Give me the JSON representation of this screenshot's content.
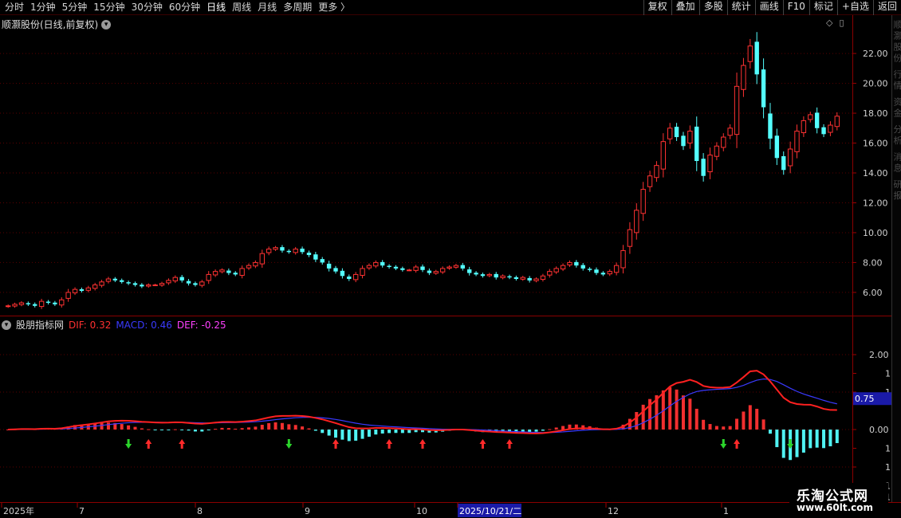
{
  "toolbar": {
    "left_items": [
      "分时",
      "1分钟",
      "5分钟",
      "15分钟",
      "30分钟",
      "60分钟",
      "日线",
      "周线",
      "月线",
      "多周期",
      "更多"
    ],
    "active": "日线",
    "more_glyph": "〉",
    "right_items": [
      "复权",
      "叠加",
      "多股",
      "统计",
      "画线",
      "F10",
      "标记",
      "+自选",
      "返回"
    ]
  },
  "main": {
    "title": "顺灏股份(日线,前复权)",
    "toggle_icon": "chevron-down-icon",
    "corner_icons": [
      "◇",
      "▯"
    ]
  },
  "price_axis": {
    "ticks": [
      "22.00",
      "20.00",
      "18.00",
      "16.00",
      "14.00",
      "12.00",
      "10.00",
      "8.00",
      "6.00"
    ]
  },
  "indicator": {
    "name": "股朋指标网",
    "dif_label": "DIF: 0.32",
    "macd_label": "MACD: 0.46",
    "def_label": "DEF: -0.25",
    "axis_ticks": [
      "2.00",
      "1",
      "1",
      "0.00",
      "1",
      "1",
      "1",
      "1"
    ],
    "current_value": "0.75"
  },
  "date_axis": {
    "labels": [
      "2025年",
      "7",
      "8",
      "9",
      "10",
      "2025/10/21/二",
      "12",
      "1"
    ]
  },
  "side_strip_text": "顺灏股份 行情 资金 分析 消息 研报",
  "watermark": {
    "name": "乐淘公式网",
    "url": "www.60lt.com"
  },
  "colors": {
    "up": "#ff3232",
    "down": "#54ffff",
    "dif": "#ff2020",
    "dea": "#3a3aff",
    "grid": "#5a0000",
    "highlight": "#1a1aa8"
  },
  "chart_data": {
    "type": "candlestick",
    "series_y_range": [
      4.5,
      23.5
    ],
    "closes": [
      5.1,
      5.2,
      5.3,
      5.2,
      5.1,
      5.4,
      5.3,
      5.2,
      5.5,
      6.0,
      6.2,
      6.1,
      6.3,
      6.5,
      6.7,
      6.9,
      6.8,
      6.7,
      6.6,
      6.5,
      6.4,
      6.5,
      6.5,
      6.6,
      6.8,
      7.0,
      6.8,
      6.6,
      6.5,
      6.7,
      7.2,
      7.4,
      7.5,
      7.3,
      7.2,
      7.6,
      7.8,
      8.0,
      8.6,
      8.9,
      9.0,
      8.8,
      8.7,
      8.9,
      8.7,
      8.5,
      8.2,
      8.0,
      7.6,
      7.4,
      7.1,
      6.9,
      7.2,
      7.6,
      7.8,
      8.0,
      7.8,
      7.7,
      7.6,
      7.5,
      7.5,
      7.7,
      7.5,
      7.3,
      7.4,
      7.6,
      7.7,
      7.8,
      7.6,
      7.3,
      7.2,
      7.1,
      7.2,
      7.0,
      7.1,
      7.0,
      6.9,
      7.0,
      6.8,
      6.9,
      7.1,
      7.4,
      7.6,
      7.8,
      8.0,
      7.8,
      7.6,
      7.5,
      7.3,
      7.2,
      7.4,
      7.8,
      8.8,
      10.2,
      11.5,
      12.9,
      13.8,
      14.5,
      16.1,
      17.0,
      16.4,
      15.8,
      16.8,
      14.8,
      13.8,
      15.2,
      15.8,
      16.4,
      17.0,
      19.8,
      21.2,
      22.5,
      20.6,
      18.4,
      16.3,
      15.0,
      14.2,
      15.6,
      16.8,
      17.5,
      17.9,
      17.0,
      16.6,
      17.2,
      17.8
    ]
  }
}
